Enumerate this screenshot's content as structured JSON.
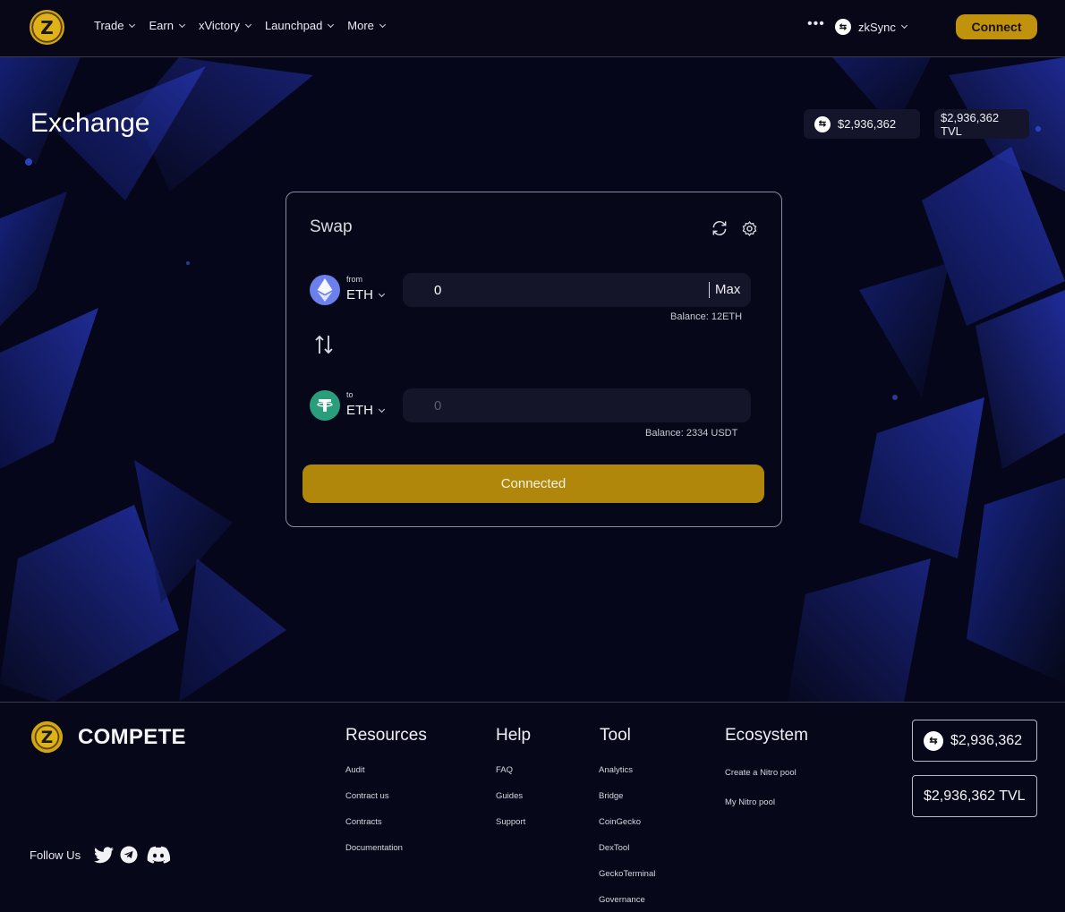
{
  "nav": {
    "logo_letter": "Z",
    "items": [
      {
        "label": "Trade"
      },
      {
        "label": "Earn"
      },
      {
        "label": "xVictory"
      },
      {
        "label": "Launchpad"
      },
      {
        "label": "More"
      }
    ],
    "more_dots": "•••",
    "network": "zkSync",
    "connect_label": "Connect"
  },
  "page": {
    "title": "Exchange",
    "stat_1": "$2,936,362",
    "stat_2": "$2,936,362 TVL"
  },
  "swap": {
    "title": "Swap",
    "from_label": "from",
    "from_token": "ETH",
    "from_value": "0",
    "max_label": "Max",
    "from_balance": "Balance: 12ETH",
    "to_label": "to",
    "to_token": "ETH",
    "to_value": "0",
    "to_balance": "Balance: 2334 USDT",
    "button_label": "Connected"
  },
  "footer": {
    "brand": "COMPETE",
    "follow_label": "Follow Us",
    "columns": [
      {
        "title": "Resources",
        "links": [
          "Audit",
          "Contract us",
          "Contracts",
          "Documentation"
        ]
      },
      {
        "title": "Help",
        "links": [
          "FAQ",
          "Guides",
          "Support"
        ]
      },
      {
        "title": "Tool",
        "links": [
          "Analytics",
          "Bridge",
          "CoinGecko",
          "DexTool",
          "GeckoTerminal",
          "Governance"
        ]
      },
      {
        "title": "Ecosystem",
        "links": [
          "Create a Nitro pool",
          "My Nitro pool"
        ]
      }
    ],
    "stat_1": "$2,936,362",
    "stat_2": "$2,936,362 TVL"
  },
  "colors": {
    "accent": "#c1930d",
    "button": "#b0870b",
    "background": "#07071a",
    "eth": "#6b80ea",
    "usdt": "#2a9d7a"
  },
  "icons": [
    "refresh-icon",
    "gear-icon",
    "eth-icon",
    "usdt-icon",
    "swap-direction-icon",
    "twitter-icon",
    "telegram-icon",
    "discord-icon",
    "zksync-icon"
  ]
}
